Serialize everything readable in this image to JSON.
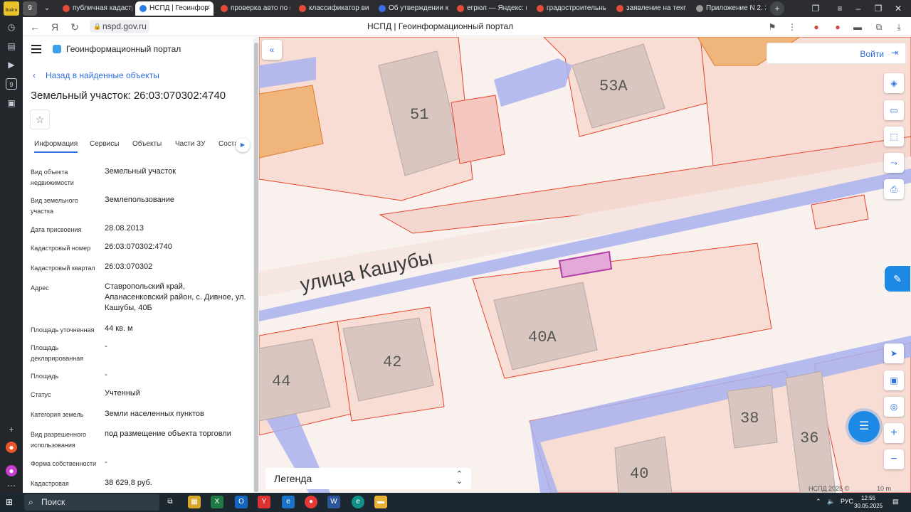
{
  "browser": {
    "tabs": [
      {
        "label": "публичная кадастр"
      },
      {
        "label": "НСПД | Геоинфор"
      },
      {
        "label": "проверка авто по в"
      },
      {
        "label": "классификатор вид"
      },
      {
        "label": "Об утверждении кл"
      },
      {
        "label": "егрюл — Яндекс: на"
      },
      {
        "label": "градостроительны"
      },
      {
        "label": "заявление на техпр"
      },
      {
        "label": "Приложение N 2. За"
      }
    ],
    "badge": "9",
    "url": "nspd.gov.ru",
    "page_title": "НСПД | Геоинформационный портал",
    "login_short": "Войти"
  },
  "panel": {
    "app_title": "Геоинформационный портал",
    "back_link": "Назад в найденные объекты",
    "title": "Земельный участок: 26:03:070302:4740",
    "tabs": [
      "Информация",
      "Сервисы",
      "Объекты",
      "Части ЗУ",
      "Соста"
    ],
    "rows": [
      {
        "label": "Вид объекта недвижимости",
        "value": "Земельный участок"
      },
      {
        "label": "Вид земельного участка",
        "value": "Землепользование"
      },
      {
        "label": "Дата присвоения",
        "value": "28.08.2013"
      },
      {
        "label": "Кадастровый номер",
        "value": "26:03:070302:4740"
      },
      {
        "label": "Кадастровый квартал",
        "value": "26:03:070302"
      },
      {
        "label": "Адрес",
        "value": "Ставропольский край, Апанасенковский район, с. Дивное, ул. Кашубы, 40Б"
      },
      {
        "label": "Площадь уточненная",
        "value": "44 кв. м"
      },
      {
        "label": "Площадь декларированная",
        "value": "-"
      },
      {
        "label": "Площадь",
        "value": "-"
      },
      {
        "label": "Статус",
        "value": "Учтенный"
      },
      {
        "label": "Категория земель",
        "value": "Земли населенных пунктов"
      },
      {
        "label": "Вид разрешенного использования",
        "value": "под размещение объекта торговли"
      },
      {
        "label": "Форма собственности",
        "value": "-"
      },
      {
        "label": "Кадастровая",
        "value": "38 629,8 руб."
      }
    ]
  },
  "map": {
    "login": "Войти",
    "legend": "Легенда",
    "street": "улица Кашубы",
    "labels": {
      "b51": "51",
      "b53a": "53А",
      "b40a": "40А",
      "b42": "42",
      "b44": "44",
      "b38": "38",
      "b36": "36",
      "b40": "40"
    },
    "copyright": "НСПД 2025 ©",
    "scale": "10 m",
    "colors": {
      "parcel_fill": "#f7ddd4",
      "parcel_border": "#e8442e",
      "building": "#d9c6c0",
      "road": "#a9b1ee",
      "orange": "#f0b57a",
      "selected": "#e4a8d9"
    }
  },
  "taskbar": {
    "search": "Поиск",
    "lang": "РУС",
    "time": "12:55",
    "date": "30.05.2025"
  }
}
